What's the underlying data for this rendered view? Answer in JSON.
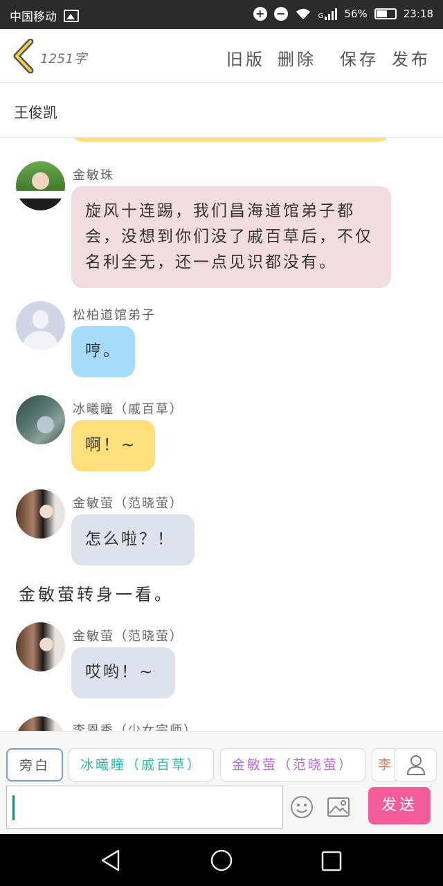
{
  "status_bar": {
    "carrier": "中国移动",
    "battery": "56%",
    "time": "23:18",
    "network_type": "G"
  },
  "header": {
    "word_count": "1251字",
    "old_version": "旧版",
    "delete": "删除",
    "save": "保存",
    "publish": "发布"
  },
  "title": "王俊凯",
  "messages": [
    {
      "name": "金敏珠",
      "text": "旋风十连踢，我们昌海道馆弟子都会，没想到你们没了戚百草后，不仅名利全无，还一点见识都没有。",
      "bubble_color": "#f2dcdd"
    },
    {
      "name": "松柏道馆弟子",
      "text": "哼。",
      "bubble_color": "#a5dcfb"
    },
    {
      "name": "冰曦瞳（戚百草）",
      "text": "啊！~",
      "bubble_color": "#fde07b"
    },
    {
      "name": "金敏萤（范晓萤）",
      "text": "怎么啦？！",
      "bubble_color": "#dde3ec"
    },
    {
      "name": "金敏萤（范晓萤）",
      "text": "哎哟！~",
      "bubble_color": "#dde3ec"
    },
    {
      "name": "李恩秀（少女宗师）"
    }
  ],
  "narration": "金敏萤转身一看。",
  "panel": {
    "chips": [
      {
        "label": "旁白",
        "color": "#555555"
      },
      {
        "label": "冰曦瞳（戚百草）",
        "color": "#2cb8a9"
      },
      {
        "label": "金敏萤（范晓萤）",
        "color": "#b56adf"
      },
      {
        "label": "李",
        "color": "#f2784b"
      }
    ],
    "send_label": "发送",
    "input_value": ""
  }
}
